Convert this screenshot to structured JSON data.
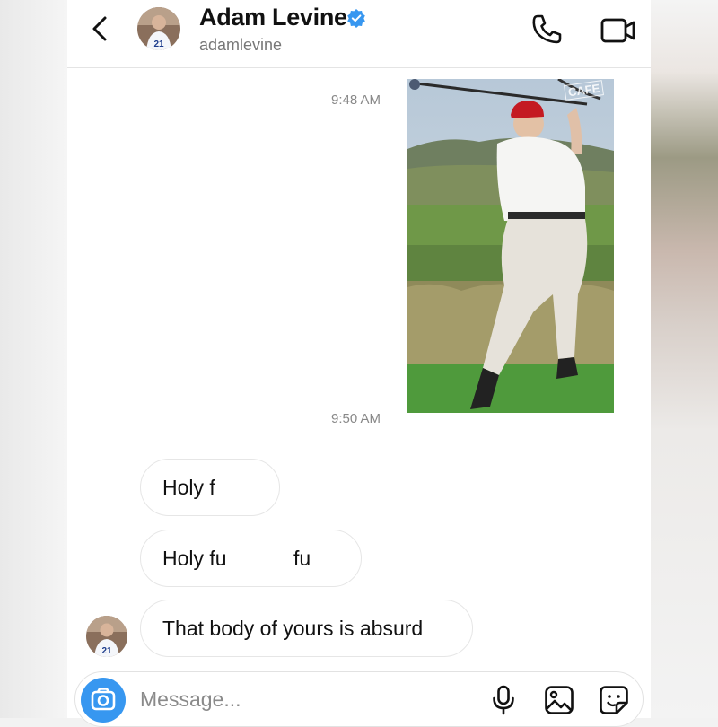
{
  "header": {
    "name": "Adam Levine",
    "handle": "adamlevine",
    "avatar_jersey_number": "21",
    "icons": [
      "back-chevron",
      "verified-badge",
      "phone-icon",
      "video-camera-icon"
    ]
  },
  "thread": {
    "timestamps": [
      "9:48 AM",
      "9:50 AM"
    ],
    "shared_photo": {
      "watermark": "CAFE"
    },
    "messages": [
      {
        "text": "Holy f"
      },
      {
        "text": "Holy fu",
        "text_tail": "fu"
      },
      {
        "text": "That body of yours is absurd"
      }
    ]
  },
  "composer": {
    "placeholder": "Message...",
    "icons": [
      "camera-icon",
      "microphone-icon",
      "gallery-icon",
      "sticker-icon"
    ]
  },
  "colors": {
    "accent": "#3797f0",
    "verified": "#3897f0",
    "text": "#111111",
    "secondary_text": "#777777",
    "bubble_border": "#e6e6e6"
  }
}
